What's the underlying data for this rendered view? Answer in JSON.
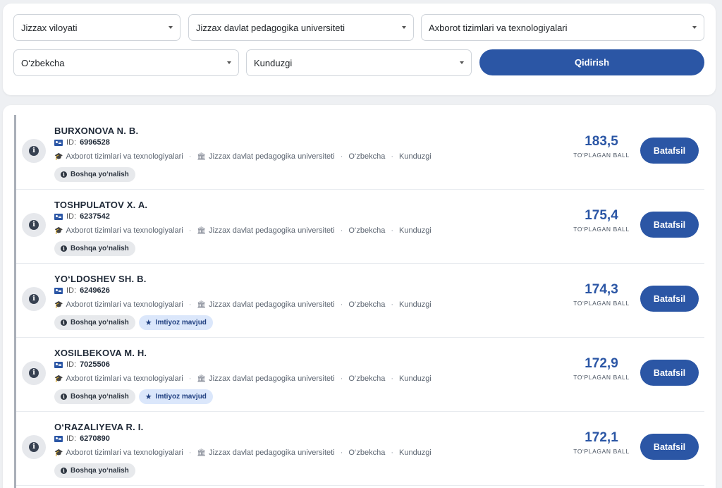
{
  "filters": {
    "region": "Jizzax viloyati",
    "university": "Jizzax davlat pedagogika universiteti",
    "direction": "Axborot tizimlari va texnologiyalari",
    "language": "O‘zbekcha",
    "study_form": "Kunduzgi",
    "search_label": "Qidirish"
  },
  "labels": {
    "id_prefix": "ID:",
    "score_label": "TO‘PLAGAN BALL",
    "detail_label": "Batafsil"
  },
  "colors": {
    "accent": "#2b56a5",
    "badge_gray": "#e7e9ec",
    "badge_blue": "#dbe7fb"
  },
  "results": [
    {
      "name": "BURXONOVA N. B.",
      "id": "6996528",
      "direction": "Axborot tizimlari va texnologiyalari",
      "university": "Jizzax davlat pedagogika universiteti",
      "language": "O‘zbekcha",
      "form": "Kunduzgi",
      "score": "183,5",
      "badges": [
        {
          "label": "Boshqa yo‘nalish",
          "kind": "gray",
          "icon": "info-icon"
        }
      ]
    },
    {
      "name": "TOSHPULATOV X. A.",
      "id": "6237542",
      "direction": "Axborot tizimlari va texnologiyalari",
      "university": "Jizzax davlat pedagogika universiteti",
      "language": "O‘zbekcha",
      "form": "Kunduzgi",
      "score": "175,4",
      "badges": [
        {
          "label": "Boshqa yo‘nalish",
          "kind": "gray",
          "icon": "info-icon"
        }
      ]
    },
    {
      "name": "YO‘LDOSHEV SH. B.",
      "id": "6249626",
      "direction": "Axborot tizimlari va texnologiyalari",
      "university": "Jizzax davlat pedagogika universiteti",
      "language": "O‘zbekcha",
      "form": "Kunduzgi",
      "score": "174,3",
      "badges": [
        {
          "label": "Boshqa yo‘nalish",
          "kind": "gray",
          "icon": "info-icon"
        },
        {
          "label": "Imtiyoz mavjud",
          "kind": "blue",
          "icon": "star-icon"
        }
      ]
    },
    {
      "name": "XOSILBEKOVA M. H.",
      "id": "7025506",
      "direction": "Axborot tizimlari va texnologiyalari",
      "university": "Jizzax davlat pedagogika universiteti",
      "language": "O‘zbekcha",
      "form": "Kunduzgi",
      "score": "172,9",
      "badges": [
        {
          "label": "Boshqa yo‘nalish",
          "kind": "gray",
          "icon": "info-icon"
        },
        {
          "label": "Imtiyoz mavjud",
          "kind": "blue",
          "icon": "star-icon"
        }
      ]
    },
    {
      "name": "O‘RAZALIYEVA R. I.",
      "id": "6270890",
      "direction": "Axborot tizimlari va texnologiyalari",
      "university": "Jizzax davlat pedagogika universiteti",
      "language": "O‘zbekcha",
      "form": "Kunduzgi",
      "score": "172,1",
      "badges": [
        {
          "label": "Boshqa yo‘nalish",
          "kind": "gray",
          "icon": "info-icon"
        }
      ]
    }
  ]
}
